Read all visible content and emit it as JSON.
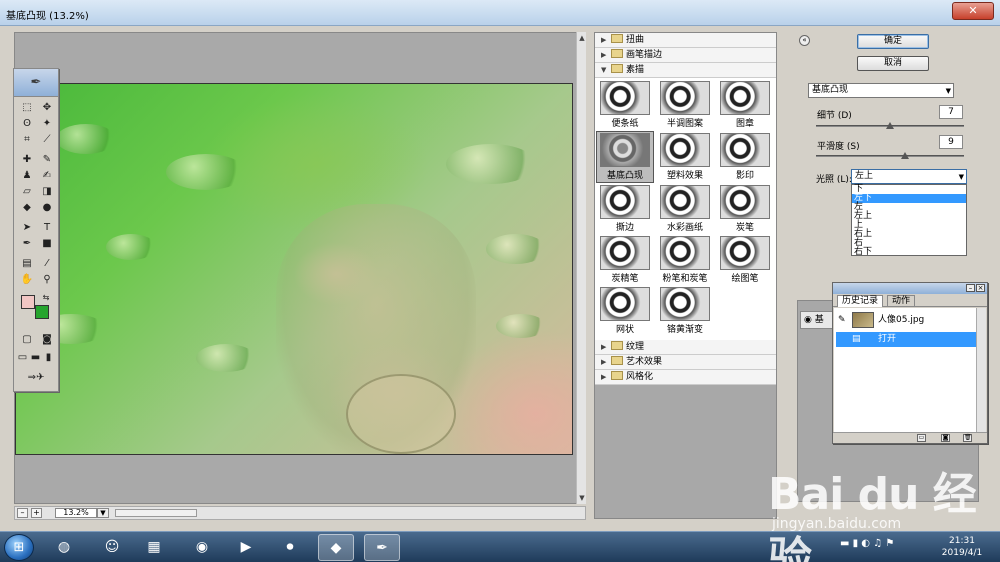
{
  "window": {
    "title": "基底凸现 (13.2%)",
    "close_label": "✕"
  },
  "zoom": {
    "value": "13.2%",
    "minus": "–",
    "plus": "+"
  },
  "gallery": {
    "categories_top": [
      {
        "label": "扭曲",
        "expanded": false
      },
      {
        "label": "画笔描边",
        "expanded": false
      },
      {
        "label": "素描",
        "expanded": true
      }
    ],
    "thumbnails": [
      {
        "label": "便条纸",
        "selected": false
      },
      {
        "label": "半调图案",
        "selected": false
      },
      {
        "label": "图章",
        "selected": false
      },
      {
        "label": "基底凸现",
        "selected": true
      },
      {
        "label": "塑料效果",
        "selected": false
      },
      {
        "label": "影印",
        "selected": false
      },
      {
        "label": "撕边",
        "selected": false
      },
      {
        "label": "水彩画纸",
        "selected": false
      },
      {
        "label": "炭笔",
        "selected": false
      },
      {
        "label": "炭精笔",
        "selected": false
      },
      {
        "label": "粉笔和炭笔",
        "selected": false
      },
      {
        "label": "绘图笔",
        "selected": false
      },
      {
        "label": "网状",
        "selected": false
      },
      {
        "label": "铬黄渐变",
        "selected": false
      }
    ],
    "categories_bottom": [
      {
        "label": "纹理"
      },
      {
        "label": "艺术效果"
      },
      {
        "label": "风格化"
      }
    ]
  },
  "actions": {
    "ok_label": "确定",
    "cancel_label": "取消"
  },
  "settings": {
    "effect_select": "基底凸现",
    "detail": {
      "label": "细节 (D)",
      "value": "7",
      "fraction": 0.5
    },
    "smoothness": {
      "label": "平滑度 (S)",
      "value": "9",
      "fraction": 0.6
    },
    "light": {
      "label": "光照 (L):",
      "value": "左上",
      "options": [
        "下",
        "左下",
        "左",
        "左上",
        "上",
        "右上",
        "右",
        "右下"
      ],
      "highlighted_index": 1
    }
  },
  "history": {
    "tabs": [
      "历史记录",
      "动作"
    ],
    "snapshot_name": "人像05.jpg",
    "step_name": "打开"
  },
  "layer": {
    "label": "基"
  },
  "taskbar": {
    "time": "21:31",
    "date": "2019/4/1"
  },
  "watermark": {
    "brand": "Bai du 经验",
    "url": "jingyan.baidu.com"
  }
}
